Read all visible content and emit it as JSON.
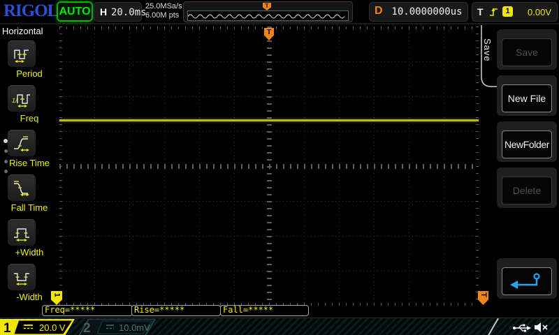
{
  "top_bar": {
    "logo": "RIGOL",
    "run_status": "AUTO",
    "horizontal": {
      "label": "H",
      "timebase": "20.0ms"
    },
    "acquisition": {
      "sample_rate": "25.0MSa/s",
      "memory_depth": "6.00M pts"
    },
    "delay": {
      "label": "D",
      "value": "10.0000000us"
    },
    "trigger": {
      "label": "T",
      "source_channel": "1",
      "level": "0.00V"
    }
  },
  "left_menu": {
    "title": "Horizontal",
    "items": [
      {
        "label": "Period"
      },
      {
        "label": "Freq"
      },
      {
        "label": "Rise Time"
      },
      {
        "label": "Fall Time"
      },
      {
        "label": "+Width"
      },
      {
        "label": "-Width"
      }
    ]
  },
  "right_menu": {
    "tab_label": "Save",
    "items": [
      {
        "label": "Save",
        "enabled": false
      },
      {
        "label": "New File",
        "enabled": true
      },
      {
        "label": "NewFolder",
        "enabled": true
      },
      {
        "label": "Delete",
        "enabled": false
      }
    ]
  },
  "graticule": {
    "trigger_marker": "T",
    "channel_offset_marker": "1",
    "trigger_level_marker": "T"
  },
  "measurements": [
    {
      "text": "Freq=*****"
    },
    {
      "text": "Rise=*****"
    },
    {
      "text": "Fall=*****"
    }
  ],
  "channel_bar": {
    "channels": [
      {
        "id": "1",
        "scale": "20.0 V",
        "active": true
      },
      {
        "id": "2",
        "scale": "10.0mV",
        "active": false
      }
    ]
  },
  "colors": {
    "accent_yellow": "#f0e800",
    "accent_orange": "#f08418",
    "accent_green": "#00e800",
    "accent_blue": "#25a5e5",
    "trace": "#bdbd00"
  }
}
